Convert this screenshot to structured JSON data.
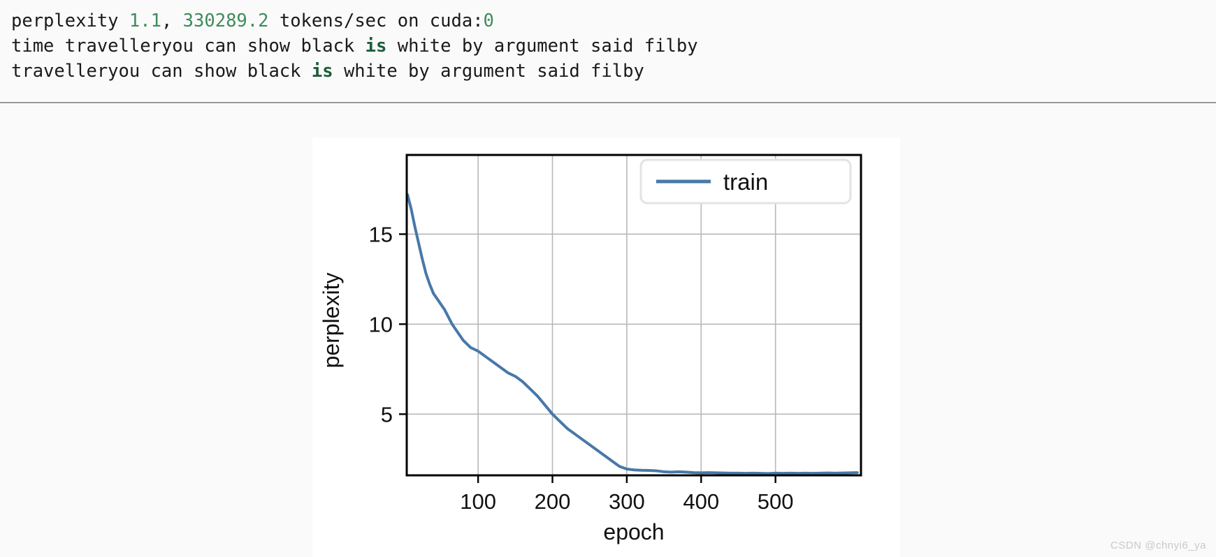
{
  "console": {
    "line1": {
      "seg1": "perplexity ",
      "num1": "1.1",
      "seg2": ", ",
      "num2": "330289.2",
      "seg3": " tokens/sec on cuda:",
      "num3": "0"
    },
    "line2": {
      "seg1": "time travelleryou can show black ",
      "bold1": "is",
      "seg2": " white by argument said filby"
    },
    "line3": {
      "seg1": "travelleryou can show black ",
      "bold1": "is",
      "seg2": " white by argument said filby"
    }
  },
  "watermark": "CSDN @chnyi6_ya",
  "chart_data": {
    "type": "line",
    "title": "",
    "xlabel": "epoch",
    "ylabel": "perplexity",
    "xlim": [
      4,
      615
    ],
    "ylim": [
      1.6,
      19.4
    ],
    "xticks": [
      100,
      200,
      300,
      400,
      500
    ],
    "xtick_labels": [
      "100",
      "200",
      "300",
      "400",
      "500"
    ],
    "yticks": [
      5,
      10,
      15
    ],
    "ytick_labels": [
      "5",
      "10",
      "15"
    ],
    "grid": true,
    "legend": {
      "position": "upper right",
      "entries": [
        {
          "label": "train",
          "color": "#4878a8"
        }
      ]
    },
    "series": [
      {
        "name": "train",
        "color": "#4878a8",
        "linewidth": 4,
        "x": [
          5,
          10,
          15,
          20,
          25,
          30,
          35,
          40,
          45,
          50,
          55,
          60,
          65,
          70,
          75,
          80,
          85,
          90,
          95,
          100,
          110,
          120,
          130,
          140,
          150,
          160,
          170,
          180,
          190,
          200,
          210,
          220,
          230,
          240,
          250,
          260,
          270,
          280,
          290,
          300,
          310,
          320,
          330,
          340,
          350,
          360,
          370,
          380,
          390,
          400,
          410,
          420,
          430,
          440,
          450,
          460,
          470,
          480,
          490,
          500,
          510,
          520,
          530,
          540,
          550,
          560,
          570,
          580,
          590,
          600,
          610
        ],
        "y": [
          17.2,
          16.4,
          15.4,
          14.5,
          13.6,
          12.8,
          12.2,
          11.7,
          11.4,
          11.1,
          10.8,
          10.4,
          10.0,
          9.7,
          9.4,
          9.1,
          8.9,
          8.7,
          8.6,
          8.5,
          8.2,
          7.9,
          7.6,
          7.3,
          7.1,
          6.8,
          6.4,
          6.0,
          5.5,
          5.0,
          4.6,
          4.2,
          3.9,
          3.6,
          3.3,
          3.0,
          2.7,
          2.4,
          2.1,
          1.95,
          1.9,
          1.88,
          1.87,
          1.85,
          1.8,
          1.78,
          1.8,
          1.78,
          1.75,
          1.74,
          1.75,
          1.74,
          1.73,
          1.72,
          1.72,
          1.71,
          1.72,
          1.71,
          1.7,
          1.72,
          1.71,
          1.72,
          1.71,
          1.72,
          1.71,
          1.72,
          1.73,
          1.72,
          1.73,
          1.74,
          1.75
        ]
      }
    ]
  }
}
